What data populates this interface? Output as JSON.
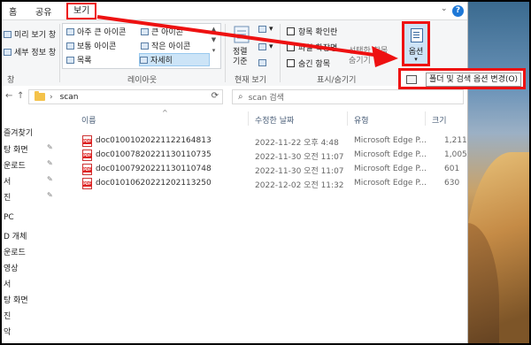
{
  "tabs": [
    "홈",
    "공유",
    "보기"
  ],
  "help": "?",
  "ribbon": {
    "pane": {
      "preview": "미리 보기 창",
      "details": "세부 정보 창",
      "label": "창"
    },
    "layout": {
      "items": [
        "아주 큰 아이콘",
        "큰 아이콘",
        "보통 아이콘",
        "작은 아이콘",
        "목록",
        "자세히"
      ],
      "label": "레이아웃"
    },
    "current_view": {
      "sort_label": "정렬\n기준",
      "label": "현재 보기"
    },
    "show_hide": {
      "items": [
        "항목 확인란",
        "파일 확장명",
        "숨긴 항목"
      ],
      "extra": "선택한 항목\n숨기기",
      "label": "표시/숨기기"
    },
    "options": {
      "label": "옵션"
    }
  },
  "popup": {
    "text": "폴더 및 검색 옵션 변경(O)"
  },
  "address": {
    "path": "scan",
    "search_placeholder": "scan 검색"
  },
  "sidebar": [
    {
      "label": "즐겨찾기",
      "pinned": false
    },
    {
      "label": "탕 화면",
      "pinned": true
    },
    {
      "label": "운로드",
      "pinned": true
    },
    {
      "label": "서",
      "pinned": true
    },
    {
      "label": "진",
      "pinned": true
    },
    {
      "label": "",
      "pinned": false
    },
    {
      "label": "PC",
      "pinned": false
    },
    {
      "label": "D 개체",
      "pinned": false
    },
    {
      "label": "운로드",
      "pinned": false
    },
    {
      "label": "영상",
      "pinned": false
    },
    {
      "label": "서",
      "pinned": false
    },
    {
      "label": "탕 화면",
      "pinned": false
    },
    {
      "label": "진",
      "pinned": false
    },
    {
      "label": "악",
      "pinned": false
    }
  ],
  "columns": [
    "이름",
    "수정한 날짜",
    "유형",
    "크기"
  ],
  "files": [
    {
      "name": "doc01001020221122164813",
      "date": "2022-11-22 오후 4:48",
      "type": "Microsoft Edge P...",
      "size": "1,211"
    },
    {
      "name": "doc01007820221130110735",
      "date": "2022-11-30 오전 11:07",
      "type": "Microsoft Edge P...",
      "size": "1,005"
    },
    {
      "name": "doc01007920221130110748",
      "date": "2022-11-30 오전 11:07",
      "type": "Microsoft Edge P...",
      "size": "601"
    },
    {
      "name": "doc01010620221202113250",
      "date": "2022-12-02 오전 11:32",
      "type": "Microsoft Edge P...",
      "size": "630"
    }
  ],
  "colors": {
    "highlight": "#e11111",
    "accent": "#1e78d7"
  }
}
